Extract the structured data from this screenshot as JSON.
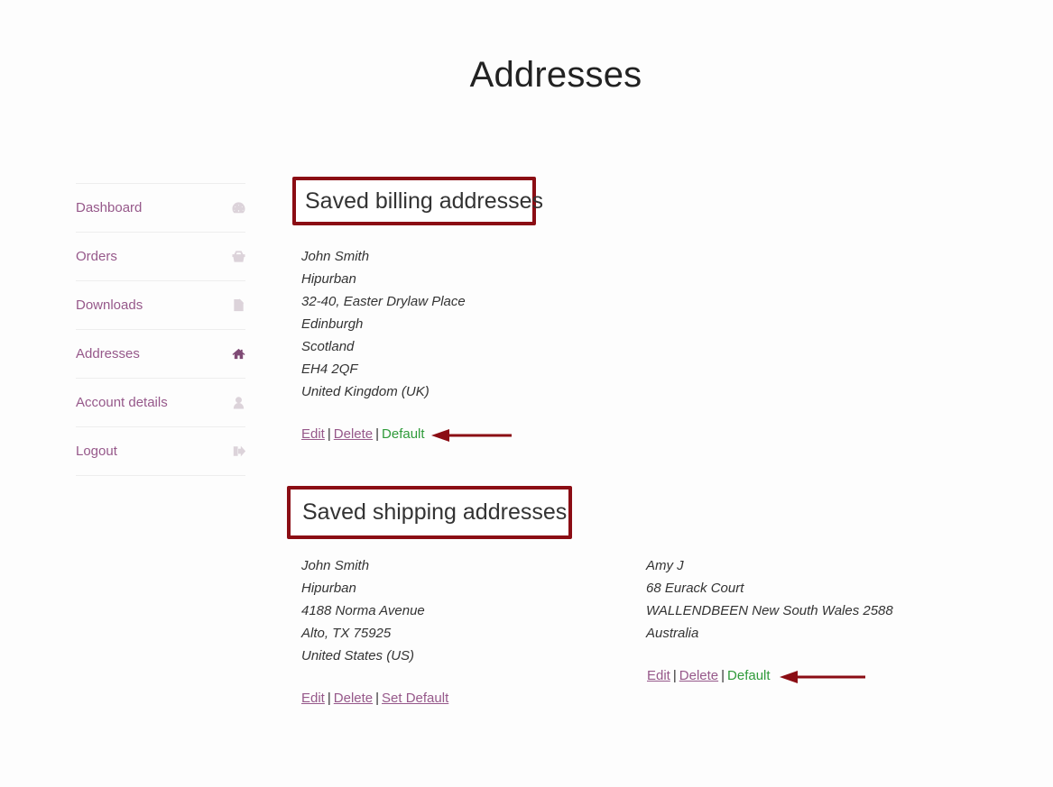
{
  "page": {
    "title": "Addresses"
  },
  "sidebar": {
    "items": [
      {
        "label": "Dashboard",
        "icon": "dashboard-icon",
        "active": false
      },
      {
        "label": "Orders",
        "icon": "basket-icon",
        "active": false
      },
      {
        "label": "Downloads",
        "icon": "file-download-icon",
        "active": false
      },
      {
        "label": "Addresses",
        "icon": "home-icon",
        "active": true
      },
      {
        "label": "Account details",
        "icon": "user-icon",
        "active": false
      },
      {
        "label": "Logout",
        "icon": "sign-out-icon",
        "active": false
      }
    ]
  },
  "billing": {
    "heading": "Saved billing addresses",
    "addresses": [
      {
        "lines": [
          "John Smith",
          "Hipurban",
          "32-40, Easter Drylaw Place",
          "Edinburgh",
          "Scotland",
          "EH4 2QF",
          "United Kingdom (UK)"
        ],
        "actions": {
          "edit": "Edit",
          "delete": "Delete",
          "status": "Default"
        },
        "is_default": true
      }
    ]
  },
  "shipping": {
    "heading": "Saved shipping addresses",
    "addresses": [
      {
        "lines": [
          "John Smith",
          "Hipurban",
          "4188 Norma Avenue",
          "Alto, TX 75925",
          "United States (US)"
        ],
        "actions": {
          "edit": "Edit",
          "delete": "Delete",
          "status": "Set Default"
        },
        "is_default": false
      },
      {
        "lines": [
          "Amy J",
          "68 Eurack Court",
          "WALLENDBEEN New South Wales 2588",
          "Australia"
        ],
        "actions": {
          "edit": "Edit",
          "delete": "Delete",
          "status": "Default"
        },
        "is_default": true
      }
    ]
  },
  "separator": "|",
  "colors": {
    "link": "#96588a",
    "default_status": "#2f9b3a",
    "annotation": "#8b0d14",
    "active_icon": "#7f4a75"
  }
}
